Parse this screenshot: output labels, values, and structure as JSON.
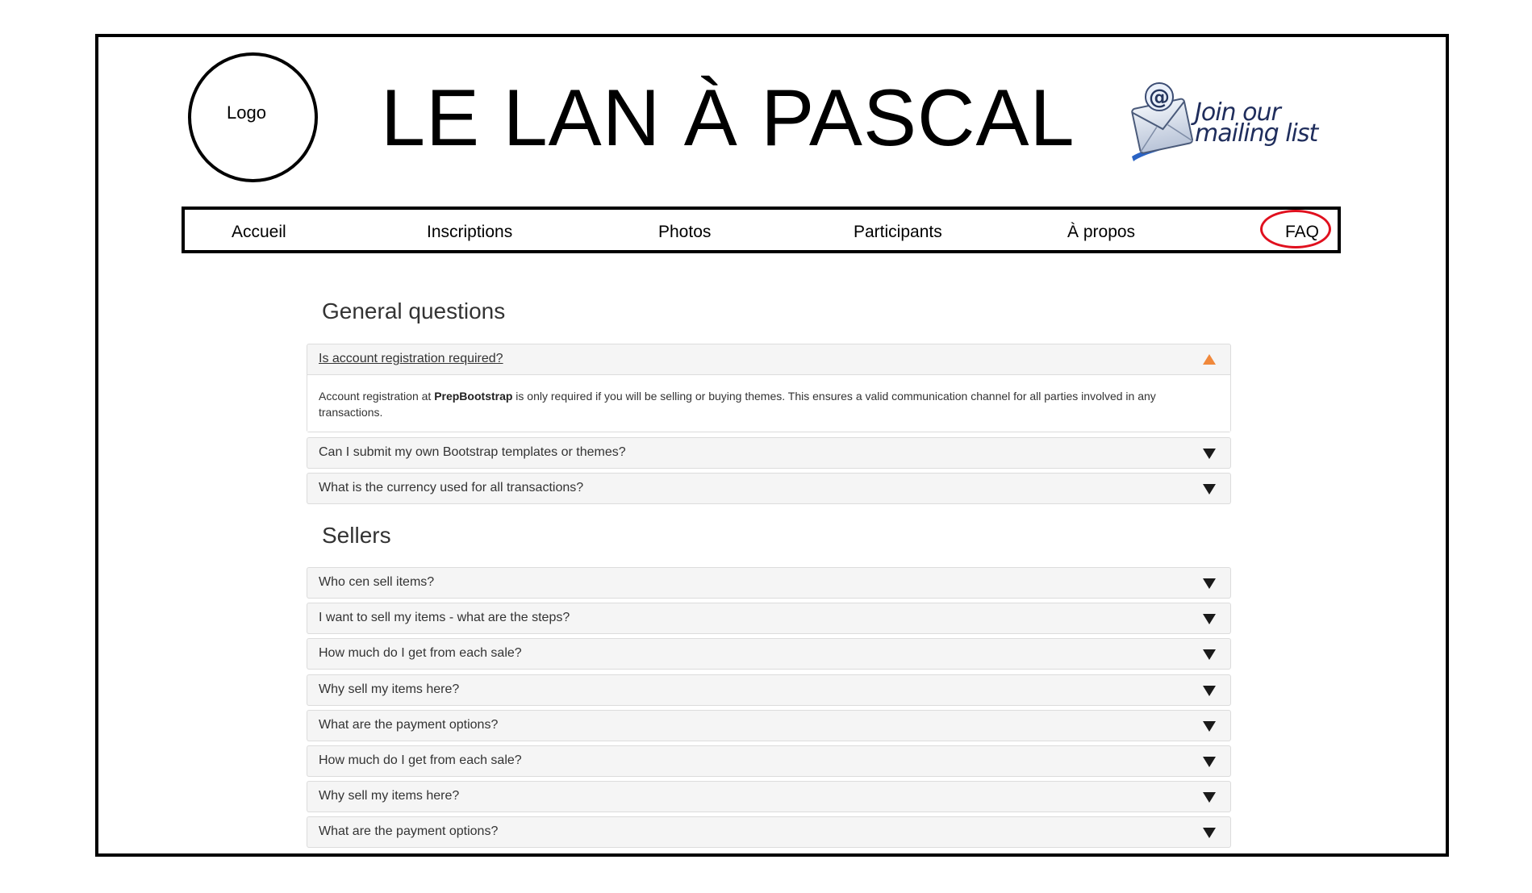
{
  "header": {
    "logo_label": "Logo",
    "site_title": "LE LAN À PASCAL",
    "mailing_line1": "Join our",
    "mailing_line2": "mailing list",
    "mailing_icon": "email-at-icon"
  },
  "nav": {
    "items": [
      {
        "label": "Accueil"
      },
      {
        "label": "Inscriptions"
      },
      {
        "label": "Photos"
      },
      {
        "label": "Participants"
      },
      {
        "label": "À propos"
      },
      {
        "label": "FAQ"
      }
    ],
    "highlight_color": "#e0101e"
  },
  "sections": [
    {
      "title": "General questions",
      "items": [
        {
          "question": "Is account registration required?",
          "expanded": true,
          "answer_before": "Account registration at ",
          "answer_bold": "PrepBootstrap",
          "answer_after": " is only required if you will be selling or buying themes. This ensures a valid communication channel for all parties involved in any transactions."
        },
        {
          "question": "Can I submit my own Bootstrap templates or themes?",
          "expanded": false
        },
        {
          "question": "What is the currency used for all transactions?",
          "expanded": false
        }
      ]
    },
    {
      "title": "Sellers",
      "items": [
        {
          "question": "Who cen sell items?",
          "expanded": false
        },
        {
          "question": "I want to sell my items - what are the steps?",
          "expanded": false
        },
        {
          "question": "How much do I get from each sale?",
          "expanded": false
        },
        {
          "question": "Why sell my items here?",
          "expanded": false
        },
        {
          "question": "What are the payment options?",
          "expanded": false
        },
        {
          "question": "How much do I get from each sale?",
          "expanded": false
        },
        {
          "question": "Why sell my items here?",
          "expanded": false
        },
        {
          "question": "What are the payment options?",
          "expanded": false
        }
      ]
    }
  ],
  "colors": {
    "expanded_arrow": "#f0883b",
    "collapsed_arrow": "#1a1a1a",
    "panel_bg": "#f5f5f5"
  }
}
